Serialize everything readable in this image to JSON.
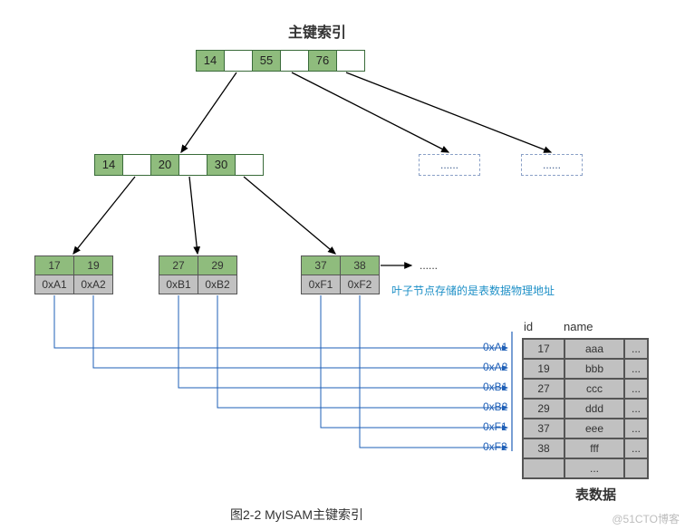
{
  "titles": {
    "top": "主键索引",
    "bottomRight": "表数据",
    "caption": "图2-2 MyISAM主键索引",
    "watermark": "@51CTO博客"
  },
  "root": {
    "keys": [
      "14",
      "55",
      "76"
    ]
  },
  "internal": {
    "keys": [
      "14",
      "20",
      "30"
    ]
  },
  "leaves": [
    {
      "keys": [
        "17",
        "19"
      ],
      "addrs": [
        "0xA1",
        "0xA2"
      ]
    },
    {
      "keys": [
        "27",
        "29"
      ],
      "addrs": [
        "0xB1",
        "0xB2"
      ]
    },
    {
      "keys": [
        "37",
        "38"
      ],
      "addrs": [
        "0xF1",
        "0xF2"
      ]
    }
  ],
  "ghost": {
    "label": "......"
  },
  "leafEll": "......",
  "annotation": "叶子节点存储的是表数据物理地址",
  "addrList": [
    "0xA1",
    "0xA2",
    "0xB1",
    "0xB2",
    "0xF1",
    "0xF2"
  ],
  "table": {
    "headers": [
      "id",
      "name",
      ""
    ],
    "rows": [
      [
        "17",
        "aaa",
        "..."
      ],
      [
        "19",
        "bbb",
        "..."
      ],
      [
        "27",
        "ccc",
        "..."
      ],
      [
        "29",
        "ddd",
        "..."
      ],
      [
        "37",
        "eee",
        "..."
      ],
      [
        "38",
        "fff",
        "..."
      ],
      [
        "",
        "...",
        ""
      ]
    ]
  },
  "chart_data": {
    "type": "table",
    "title": "MyISAM主键索引 B+Tree",
    "tree": {
      "root": [
        14,
        55,
        76
      ],
      "children_of_first_subtree": [
        14,
        20,
        30
      ],
      "leaves": [
        {
          "keys": [
            17,
            19
          ],
          "pointers": [
            "0xA1",
            "0xA2"
          ]
        },
        {
          "keys": [
            27,
            29
          ],
          "pointers": [
            "0xB1",
            "0xB2"
          ]
        },
        {
          "keys": [
            37,
            38
          ],
          "pointers": [
            "0xF1",
            "0xF2"
          ]
        }
      ]
    },
    "data_table": [
      {
        "addr": "0xA1",
        "id": 17,
        "name": "aaa"
      },
      {
        "addr": "0xA2",
        "id": 19,
        "name": "bbb"
      },
      {
        "addr": "0xB1",
        "id": 27,
        "name": "ccc"
      },
      {
        "addr": "0xB2",
        "id": 29,
        "name": "ddd"
      },
      {
        "addr": "0xF1",
        "id": 37,
        "name": "eee"
      },
      {
        "addr": "0xF2",
        "id": 38,
        "name": "fff"
      }
    ]
  }
}
